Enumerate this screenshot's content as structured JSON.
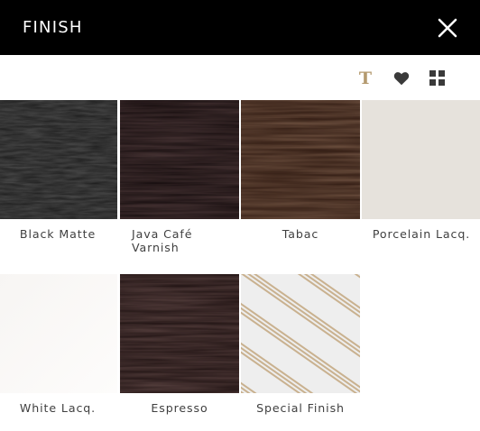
{
  "header": {
    "title": "FINISH",
    "close_icon": "close-icon",
    "background": "#000000"
  },
  "toolbar": {
    "text_tool_glyph": "T",
    "text_tool_color": "#b49a6f",
    "icons": [
      "text-icon",
      "heart-icon",
      "grid-icon"
    ]
  },
  "finishes": [
    {
      "label": "Black Matte",
      "swatch": "black-matte"
    },
    {
      "label": "Java Café Varnish",
      "swatch": "java-cafe-varnish"
    },
    {
      "label": "Tabac",
      "swatch": "tabac"
    },
    {
      "label": "Porcelain Lacq.",
      "swatch": "porcelain-lacquer"
    },
    {
      "label": "White Lacq.",
      "swatch": "white-lacquer"
    },
    {
      "label": "Espresso",
      "swatch": "espresso"
    },
    {
      "label": "Special Finish",
      "swatch": "special-finish"
    }
  ]
}
